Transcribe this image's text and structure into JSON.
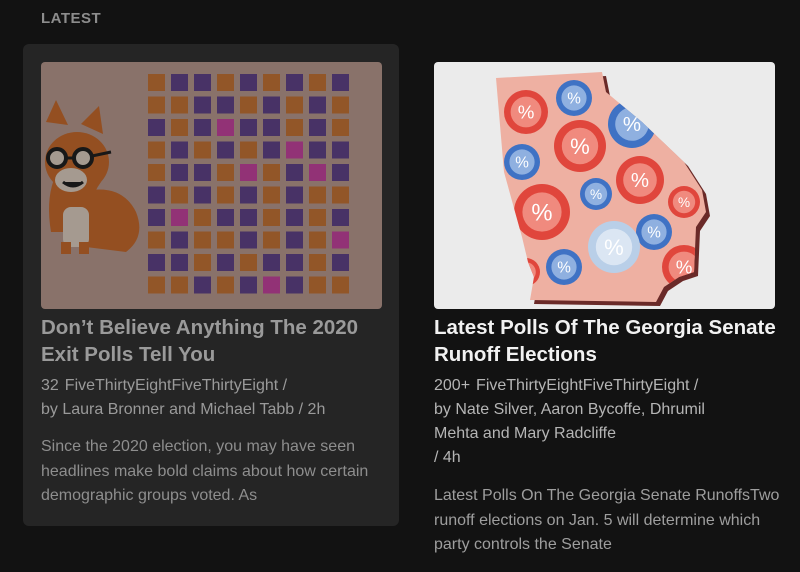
{
  "section": {
    "label": "LATEST"
  },
  "articles": [
    {
      "title": "Don’t Believe Anything The 2020 Exit Polls Tell You",
      "count": "32",
      "byline_lines": [
        "FiveThirtyEightFiveThirtyEight /",
        "by Laura Bronner and Michael Tabb / 2h"
      ],
      "description": "Since the 2020 election, you may have seen headlines make bold claims about how certain demographic groups voted. As"
    },
    {
      "title": "Latest Polls Of The Georgia Senate Runoff Elections",
      "count": "200+",
      "byline_lines": [
        "FiveThirtyEightFiveThirtyEight /",
        "by Nate Silver, Aaron Bycoffe, Dhrumil",
        "Mehta and Mary Radcliffe",
        "/ 4h"
      ],
      "description": "Latest Polls On The Georgia Senate RunoffsTwo runoff elections on Jan. 5 will determine which party controls the Senate"
    }
  ],
  "colors": {
    "grid_orange": "#d6742a",
    "grid_purple": "#5e3a8e",
    "grid_pink": "#d63aa8",
    "poll_red": "#e0463c",
    "poll_blue": "#3f72c4",
    "map_fill": "#eeb0a2"
  },
  "icons": [
    "fox-mascot-icon",
    "percent-icon"
  ]
}
